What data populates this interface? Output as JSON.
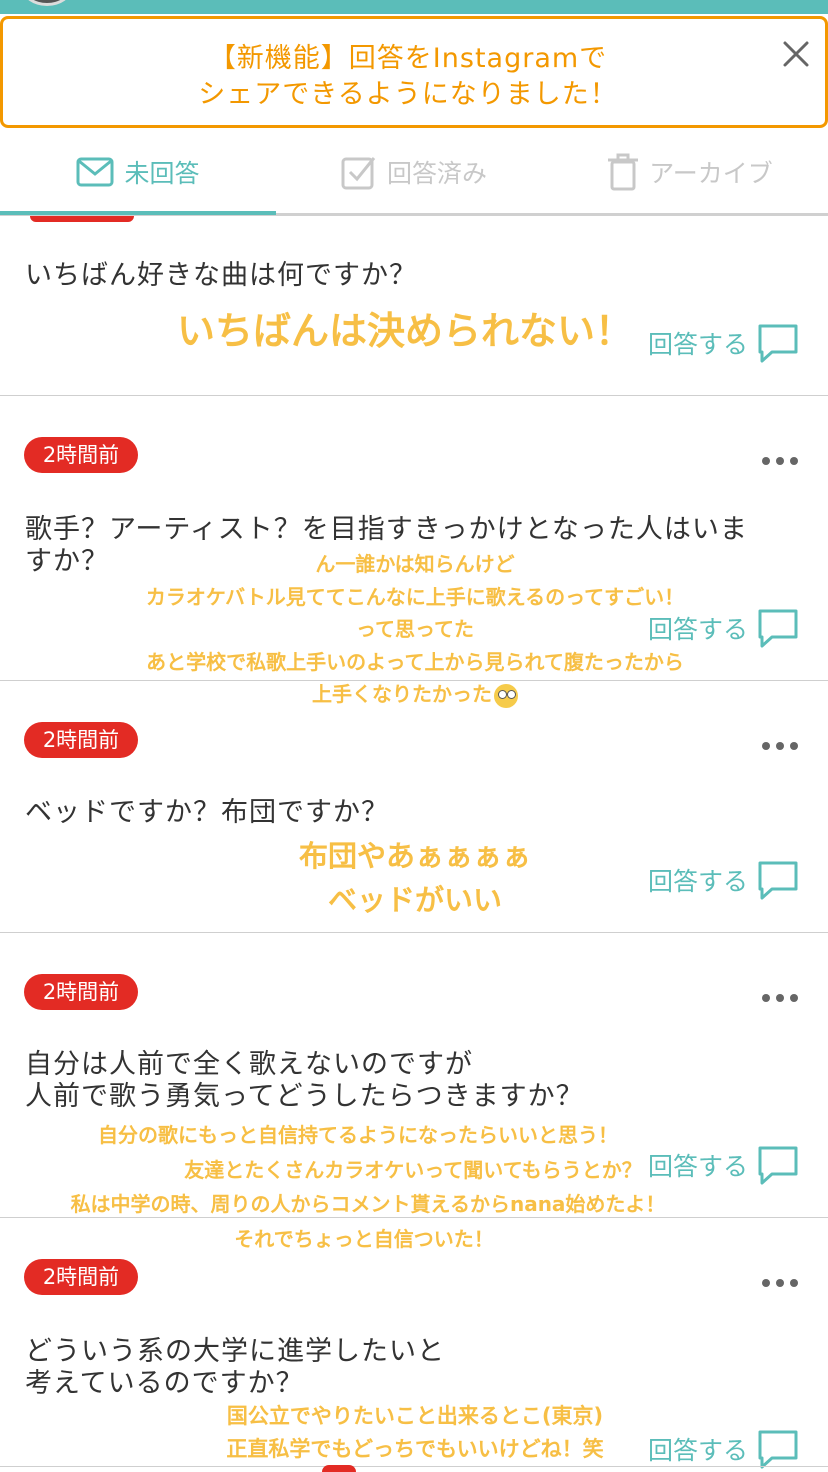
{
  "banner": {
    "line1": "【新機能】回答をInstagramで",
    "line2": "シェアできるようになりました！"
  },
  "tabs": [
    {
      "label": "未回答",
      "icon": "mail-icon",
      "active": true
    },
    {
      "label": "回答済み",
      "icon": "checkbox-icon",
      "active": false
    },
    {
      "label": "アーカイブ",
      "icon": "trash-icon",
      "active": false
    }
  ],
  "answer_label": "回答する",
  "colors": {
    "accent": "#5bbdb9",
    "banner": "#f39800",
    "badge": "#e32b24",
    "handwriting": "#f7bf45"
  },
  "cards": [
    {
      "question": "いちばん好きな曲は何ですか？",
      "overlay": [
        "いちばんは決められない！"
      ]
    },
    {
      "time": "2時間前",
      "question": [
        "歌手？アーティスト？を目指すきっかけとなった人はいま",
        "すか？"
      ],
      "overlay": [
        "ん一誰かは知らんけど",
        "カラオケバトル見ててこんなに上手に歌えるのってすごい！",
        "って思ってた",
        "あと学校で私歌上手いのよって上から見られて腹たったから",
        "上手くなりたかった"
      ]
    },
    {
      "time": "2時間前",
      "question": "ベッドですか？布団ですか？",
      "overlay": [
        "布団やあぁぁぁぁ",
        "ベッドがいい"
      ]
    },
    {
      "time": "2時間前",
      "question": [
        "自分は人前で全く歌えないのですが",
        "人前で歌う勇気ってどうしたらつきますか？"
      ],
      "overlay": [
        "自分の歌にもっと自信持てるようになったらいいと思う！",
        "友達とたくさんカラオケいって聞いてもらうとか？",
        "私は中学の時、周りの人からコメント貰えるからnana始めたよ！",
        "それでちょっと自信ついた！"
      ]
    },
    {
      "time": "2時間前",
      "question": [
        "どういう系の大学に進学したいと",
        "考えているのですか？"
      ],
      "overlay": [
        "国公立でやりたいこと出来るとこ(東京)",
        "正直私学でもどっちでもいいけどね！笑"
      ]
    }
  ]
}
